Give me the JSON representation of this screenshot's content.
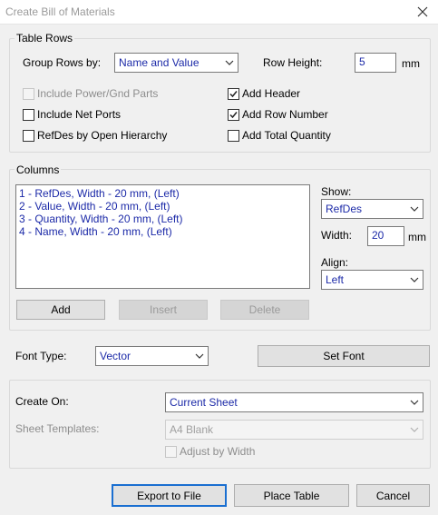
{
  "dialog": {
    "title": "Create Bill of Materials"
  },
  "icons": {
    "close": "close-icon",
    "chevron": "chevron-down-icon",
    "check": "check-icon"
  },
  "table_rows": {
    "group_label": "Table Rows",
    "group_rows_by_label": "Group Rows by:",
    "group_rows_by_value": "Name and Value",
    "row_height_label": "Row Height:",
    "row_height_value": "5",
    "row_height_unit": "mm",
    "checkboxes": {
      "include_power_gnd": {
        "label": "Include Power/Gnd Parts",
        "checked": false,
        "enabled": false
      },
      "include_net_ports": {
        "label": "Include Net Ports",
        "checked": false,
        "enabled": true
      },
      "refdes_by_hierarchy": {
        "label": "RefDes by Open Hierarchy",
        "checked": false,
        "enabled": true
      },
      "add_header": {
        "label": "Add Header",
        "checked": true,
        "enabled": true
      },
      "add_row_number": {
        "label": "Add Row Number",
        "checked": true,
        "enabled": true
      },
      "add_total_quantity": {
        "label": "Add Total Quantity",
        "checked": false,
        "enabled": true
      }
    }
  },
  "columns": {
    "group_label": "Columns",
    "items": [
      "1 - RefDes, Width - 20 mm, (Left)",
      "2 - Value, Width - 20 mm, (Left)",
      "3 - Quantity, Width - 20 mm, (Left)",
      "4 - Name, Width - 20 mm, (Left)"
    ],
    "show_label": "Show:",
    "show_value": "RefDes",
    "width_label": "Width:",
    "width_value": "20",
    "width_unit": "mm",
    "align_label": "Align:",
    "align_value": "Left",
    "add_button": "Add",
    "insert_button": "Insert",
    "delete_button": "Delete"
  },
  "font": {
    "label": "Font Type:",
    "value": "Vector",
    "set_font_button": "Set Font"
  },
  "create": {
    "create_on_label": "Create On:",
    "create_on_value": "Current Sheet",
    "sheet_templates_label": "Sheet Templates:",
    "sheet_templates_value": "A4 Blank",
    "adjust_by_width_label": "Adjust by Width",
    "adjust_by_width_checked": false
  },
  "buttons": {
    "export": "Export to File",
    "place": "Place Table",
    "cancel": "Cancel"
  },
  "colors": {
    "accent": "#1a6fd1",
    "value_text": "#1c2aa8",
    "background": "#f0f0f0"
  }
}
